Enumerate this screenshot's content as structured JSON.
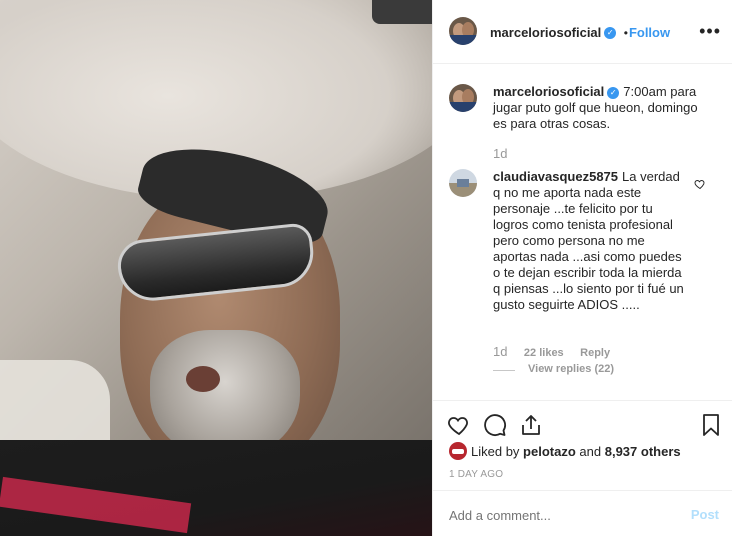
{
  "post": {
    "username": "marceloriosoficial",
    "follow_label": "Follow",
    "more_label": "•••",
    "separator": "•",
    "verified_glyph": "✓",
    "caption_text": "7:00am para jugar puto golf que hueon, domingo es para otras cosas.",
    "caption_time": "1d"
  },
  "comment": {
    "username": "claudiavasquez5875",
    "text": "La verdad q no me aporta nada este personaje ...te felicito por tu logros como tenista profesional pero como persona no me aportas nada ...asi como puedes o te dejan escribir toda la mierda q piensas ...lo siento por ti fué un gusto seguirte ADIOS .....",
    "time": "1d",
    "likes": "22 likes",
    "reply_label": "Reply",
    "view_replies": "View replies (22)"
  },
  "engagement": {
    "liked_prefix": "Liked by",
    "liked_user": "pelotazo",
    "liked_join": "and",
    "liked_count": "8,937 others",
    "date": "1 DAY AGO"
  },
  "add_comment": {
    "placeholder": "Add a comment...",
    "post_label": "Post"
  },
  "icons": {
    "like": "heart-icon",
    "comment": "speech-bubble-icon",
    "share": "share-icon",
    "save": "bookmark-icon",
    "comment_like": "small-heart-icon"
  },
  "colors": {
    "accent": "#3897f0",
    "text": "#262626",
    "muted": "#999999"
  }
}
